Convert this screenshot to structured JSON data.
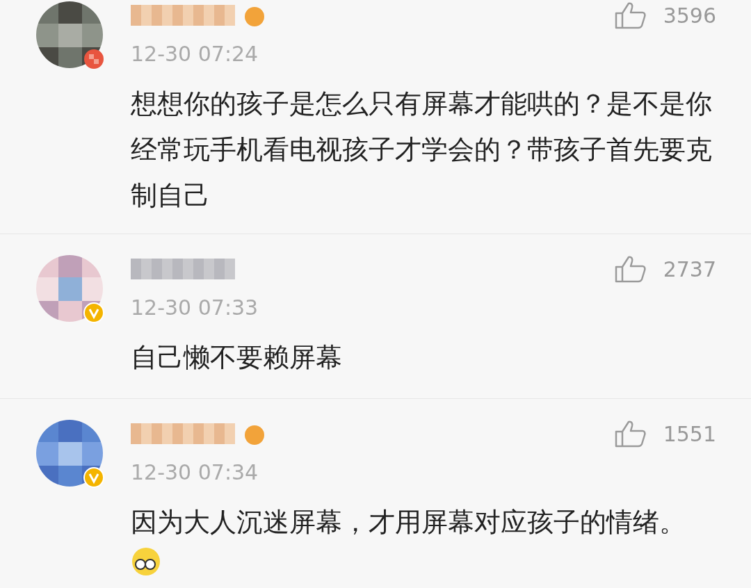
{
  "comments": [
    {
      "verified": false,
      "medal": true,
      "time": "12-30 07:24",
      "likes": "3596",
      "text": "想想你的孩子是怎么只有屏幕才能哄的？是不是你经常玩手机看电视孩子才学会的？带孩子首先要克制自己",
      "emoji": false
    },
    {
      "verified": true,
      "medal": false,
      "time": "12-30 07:33",
      "likes": "2737",
      "text": "自己懒不要赖屏幕",
      "emoji": false
    },
    {
      "verified": true,
      "medal": true,
      "time": "12-30 07:34",
      "likes": "1551",
      "text": "因为大人沉迷屏幕，才用屏幕对应孩子的情绪。",
      "emoji": true
    }
  ]
}
